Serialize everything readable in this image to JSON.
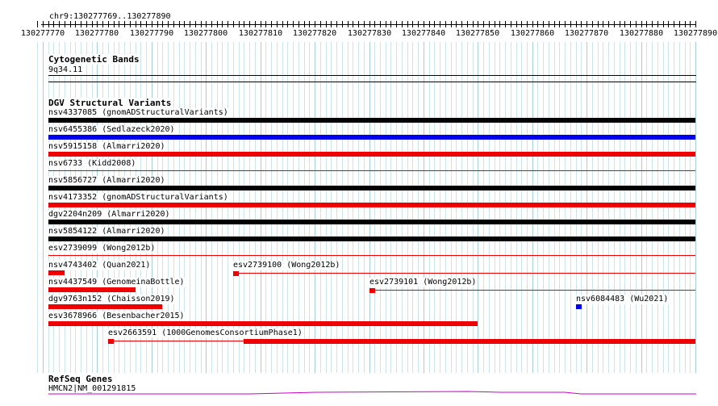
{
  "ruler": {
    "location": "chr9:130277769..130277890",
    "start": 130277770,
    "end": 130277890,
    "ticks": [
      "130277770",
      "130277780",
      "130277790",
      "130277800",
      "130277810",
      "130277820",
      "130277830",
      "130277840",
      "130277850",
      "130277860",
      "130277870",
      "130277880",
      "130277890"
    ]
  },
  "tracks": {
    "cytogenetic": {
      "title": "Cytogenetic Bands",
      "band": "9q34.11"
    },
    "dgv": {
      "title": "DGV Structural Variants",
      "features": [
        {
          "id": "nsv4337085",
          "source": "gnomADStructuralVariants",
          "color": "#000000",
          "start": 130277769,
          "end": 130277890,
          "label": "nsv4337085 (gnomADStructuralVariants)"
        },
        {
          "id": "nsv6455386",
          "source": "Sedlazeck2020",
          "color": "#0000ee",
          "start": 130277769,
          "end": 130277890,
          "label": "nsv6455386 (Sedlazeck2020)"
        },
        {
          "id": "nsv5915158",
          "source": "Almarri2020",
          "color": "#ee0000",
          "start": 130277769,
          "end": 130277890,
          "label": "nsv5915158 (Almarri2020)"
        },
        {
          "id": "nsv6733",
          "source": "Kidd2008",
          "color": "#ee0000",
          "start": 130277769,
          "end": 130277890,
          "label": "nsv6733 (Kidd2008)"
        },
        {
          "id": "nsv5856727",
          "source": "Almarri2020",
          "color": "#000000",
          "start": 130277769,
          "end": 130277890,
          "label": "nsv5856727 (Almarri2020)"
        },
        {
          "id": "nsv4173352",
          "source": "gnomADStructuralVariants",
          "color": "#ee0000",
          "start": 130277769,
          "end": 130277890,
          "label": "nsv4173352 (gnomADStructuralVariants)"
        },
        {
          "id": "dgv2204n209",
          "source": "Almarri2020",
          "color": "#000000",
          "start": 130277769,
          "end": 130277890,
          "label": "dgv2204n209 (Almarri2020)"
        },
        {
          "id": "nsv5854122",
          "source": "Almarri2020",
          "color": "#000000",
          "start": 130277769,
          "end": 130277890,
          "label": "nsv5854122 (Almarri2020)"
        },
        {
          "id": "esv2739099",
          "source": "Wong2012b",
          "color": "#ee0000",
          "start": 130277769,
          "end": 130277890,
          "label": "esv2739099 (Wong2012b)"
        },
        {
          "id": "nsv4743402",
          "source": "Quan2021",
          "color": "#ee0000",
          "start": 130277769,
          "end": 130277774,
          "label": "nsv4743402 (Quan2021)"
        },
        {
          "id": "esv2739100",
          "source": "Wong2012b",
          "color": "#ee0000",
          "start": 130277805,
          "end": 130277890,
          "label": "esv2739100 (Wong2012b)"
        },
        {
          "id": "nsv4437549",
          "source": "GenomeinaBottle",
          "color": "#ee0000",
          "start": 130277769,
          "end": 130277787,
          "label": "nsv4437549 (GenomeinaBottle)"
        },
        {
          "id": "esv2739101",
          "source": "Wong2012b",
          "color": "#ee0000",
          "start": 130277830,
          "end": 130277890,
          "label": "esv2739101 (Wong2012b)"
        },
        {
          "id": "dgv9763n152",
          "source": "Chaisson2019",
          "color": "#ee0000",
          "start": 130277769,
          "end": 130277792,
          "label": "dgv9763n152 (Chaisson2019)"
        },
        {
          "id": "nsv6084483",
          "source": "Wu2021",
          "color": "#0000ee",
          "start": 130277868,
          "end": 130277869,
          "label": "nsv6084483 (Wu2021)"
        },
        {
          "id": "esv3678966",
          "source": "Besenbacher2015",
          "color": "#ee0000",
          "start": 130277769,
          "end": 130277850,
          "label": "esv3678966 (Besenbacher2015)"
        },
        {
          "id": "esv2663591",
          "source": "1000GenomesConsortiumPhase1",
          "color": "#ee0000",
          "start": 130277782,
          "end": 130277890,
          "label": "esv2663591 (1000GenomesConsortiumPhase1)"
        }
      ]
    },
    "refseq": {
      "title": "RefSeq Genes",
      "gene": "HMCN2|NM_001291815",
      "color": "#cc00cc"
    }
  }
}
